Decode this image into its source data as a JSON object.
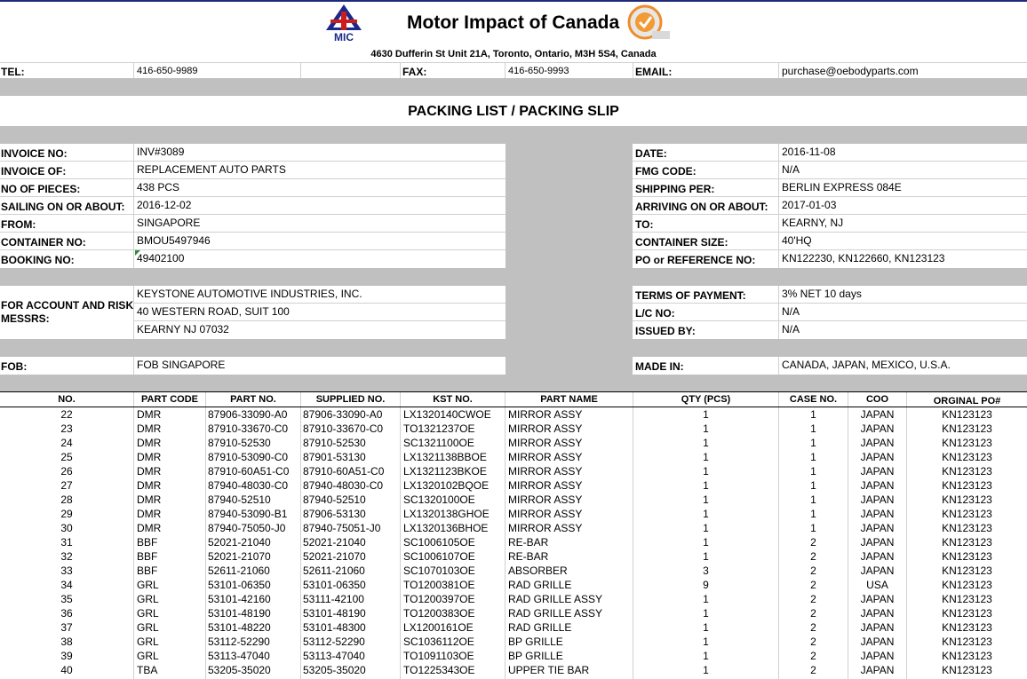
{
  "header": {
    "company": "Motor Impact of Canada",
    "logo_text": "MIC",
    "address": "4630 Dufferin St Unit 21A, Toronto, Ontario, M3H 5S4, Canada",
    "tel_label": "TEL:",
    "tel": "416-650-9989",
    "fax_label": "FAX:",
    "fax": "416-650-9993",
    "email_label": "EMAIL:",
    "email": "purchase@oebodyparts.com"
  },
  "title": "PACKING LIST  / PACKING SLIP",
  "left_fields": [
    {
      "label": "INVOICE NO:",
      "value": "INV#3089"
    },
    {
      "label": "INVOICE OF:",
      "value": "REPLACEMENT AUTO PARTS"
    },
    {
      "label": "NO OF PIECES:",
      "value": "438 PCS"
    },
    {
      "label": "SAILING ON OR ABOUT:",
      "value": "2016-12-02"
    },
    {
      "label": "FROM:",
      "value": "SINGAPORE"
    },
    {
      "label": "CONTAINER NO:",
      "value": "BMOU5497946"
    },
    {
      "label": "BOOKING NO:",
      "value": "49402100"
    }
  ],
  "right_fields": [
    {
      "label": "DATE:",
      "value": "2016-11-08"
    },
    {
      "label": "FMG CODE:",
      "value": "N/A"
    },
    {
      "label": "SHIPPING PER:",
      "value": "BERLIN EXPRESS 084E"
    },
    {
      "label": "ARRIVING ON OR ABOUT:",
      "value": "2017-01-03"
    },
    {
      "label": "TO:",
      "value": "KEARNY, NJ"
    },
    {
      "label": "CONTAINER SIZE:",
      "value": "40'HQ"
    },
    {
      "label": "PO or REFERENCE NO:",
      "value": "KN122230, KN122660, KN123123"
    }
  ],
  "account": {
    "label_line1": "FOR ACCOUNT AND RISK",
    "label_line2": "MESSRS:",
    "lines": [
      "KEYSTONE AUTOMOTIVE INDUSTRIES, INC.",
      "40 WESTERN ROAD, SUIT 100",
      "KEARNY NJ 07032"
    ]
  },
  "terms": [
    {
      "label": "TERMS OF PAYMENT:",
      "value": "3% NET 10 days"
    },
    {
      "label": "L/C NO:",
      "value": "N/A"
    },
    {
      "label": "ISSUED BY:",
      "value": "N/A"
    }
  ],
  "fob": {
    "label": "FOB:",
    "value": "FOB SINGAPORE"
  },
  "made_in": {
    "label": "MADE IN:",
    "value": "CANADA, JAPAN, MEXICO, U.S.A."
  },
  "table": {
    "headers": [
      "NO.",
      "PART CODE",
      "PART NO.",
      "SUPPLIED NO.",
      "KST NO.",
      "PART NAME",
      "QTY (PCS)",
      "CASE NO.",
      "COO",
      "ORGINAL PO#"
    ],
    "rows": [
      [
        "22",
        "DMR",
        "87906-33090-A0",
        "87906-33090-A0",
        "LX1320140CWOE",
        "MIRROR ASSY",
        "1",
        "1",
        "JAPAN",
        "KN123123"
      ],
      [
        "23",
        "DMR",
        "87910-33670-C0",
        "87910-33670-C0",
        "TO1321237OE",
        "MIRROR ASSY",
        "1",
        "1",
        "JAPAN",
        "KN123123"
      ],
      [
        "24",
        "DMR",
        "87910-52530",
        "87910-52530",
        "SC1321100OE",
        "MIRROR ASSY",
        "1",
        "1",
        "JAPAN",
        "KN123123"
      ],
      [
        "25",
        "DMR",
        "87910-53090-C0",
        "87901-53130",
        "LX1321138BBOE",
        "MIRROR ASSY",
        "1",
        "1",
        "JAPAN",
        "KN123123"
      ],
      [
        "26",
        "DMR",
        "87910-60A51-C0",
        "87910-60A51-C0",
        "LX1321123BKOE",
        "MIRROR ASSY",
        "1",
        "1",
        "JAPAN",
        "KN123123"
      ],
      [
        "27",
        "DMR",
        "87940-48030-C0",
        "87940-48030-C0",
        "LX1320102BQOE",
        "MIRROR ASSY",
        "1",
        "1",
        "JAPAN",
        "KN123123"
      ],
      [
        "28",
        "DMR",
        "87940-52510",
        "87940-52510",
        "SC1320100OE",
        "MIRROR ASSY",
        "1",
        "1",
        "JAPAN",
        "KN123123"
      ],
      [
        "29",
        "DMR",
        "87940-53090-B1",
        "87906-53130",
        "LX1320138GHOE",
        "MIRROR ASSY",
        "1",
        "1",
        "JAPAN",
        "KN123123"
      ],
      [
        "30",
        "DMR",
        "87940-75050-J0",
        "87940-75051-J0",
        "LX1320136BHOE",
        "MIRROR ASSY",
        "1",
        "1",
        "JAPAN",
        "KN123123"
      ],
      [
        "31",
        "BBF",
        "52021-21040",
        "52021-21040",
        "SC1006105OE",
        "RE-BAR",
        "1",
        "2",
        "JAPAN",
        "KN123123"
      ],
      [
        "32",
        "BBF",
        "52021-21070",
        "52021-21070",
        "SC1006107OE",
        "RE-BAR",
        "1",
        "2",
        "JAPAN",
        "KN123123"
      ],
      [
        "33",
        "BBF",
        "52611-21060",
        "52611-21060",
        "SC1070103OE",
        "ABSORBER",
        "3",
        "2",
        "JAPAN",
        "KN123123"
      ],
      [
        "34",
        "GRL",
        "53101-06350",
        "53101-06350",
        "TO1200381OE",
        "RAD GRILLE",
        "9",
        "2",
        "USA",
        "KN123123"
      ],
      [
        "35",
        "GRL",
        "53101-42160",
        "53111-42100",
        "TO1200397OE",
        "RAD GRILLE ASSY",
        "1",
        "2",
        "JAPAN",
        "KN123123"
      ],
      [
        "36",
        "GRL",
        "53101-48190",
        "53101-48190",
        "TO1200383OE",
        "RAD GRILLE ASSY",
        "1",
        "2",
        "JAPAN",
        "KN123123"
      ],
      [
        "37",
        "GRL",
        "53101-48220",
        "53101-48300",
        "LX1200161OE",
        "RAD GRILLE",
        "1",
        "2",
        "JAPAN",
        "KN123123"
      ],
      [
        "38",
        "GRL",
        "53112-52290",
        "53112-52290",
        "SC1036112OE",
        "BP GRILLE",
        "1",
        "2",
        "JAPAN",
        "KN123123"
      ],
      [
        "39",
        "GRL",
        "53113-47040",
        "53113-47040",
        "TO1091103OE",
        "BP GRILLE",
        "1",
        "2",
        "JAPAN",
        "KN123123"
      ],
      [
        "40",
        "TBA",
        "53205-35020",
        "53205-35020",
        "TO1225343OE",
        "UPPER TIE BAR",
        "1",
        "2",
        "JAPAN",
        "KN123123"
      ]
    ]
  }
}
